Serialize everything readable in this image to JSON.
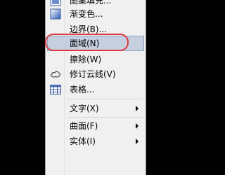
{
  "menu": {
    "items": [
      {
        "label": "图案填充...",
        "has_icon": true
      },
      {
        "label": "渐变色...",
        "has_icon": true
      },
      {
        "label": "边界(B)..."
      },
      {
        "label": "面域(N)",
        "selected": true
      },
      {
        "label": "擦除(W)"
      },
      {
        "label": "修订云线(V)",
        "has_icon": true
      },
      {
        "label": "表格...",
        "has_icon": true
      },
      {
        "label": "文字(X)",
        "submenu": true
      },
      {
        "label": "曲面(F)",
        "submenu": true
      },
      {
        "label": "实体(I)",
        "submenu": true
      }
    ]
  },
  "colors": {
    "background": "#000000",
    "menu_bg": "#f0f0f0",
    "selection": "#c6cfe0",
    "annotation_ring": "#e0383e"
  }
}
